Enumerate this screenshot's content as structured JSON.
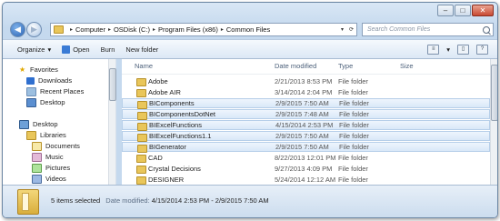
{
  "address": {
    "crumbs": [
      "Computer",
      "OSDisk (C:)",
      "Program Files (x86)",
      "Common Files"
    ]
  },
  "search": {
    "placeholder": "Search Common Files"
  },
  "toolbar": {
    "organize": "Organize",
    "open": "Open",
    "burn": "Burn",
    "new_folder": "New folder"
  },
  "nav": {
    "favorites": "Favorites",
    "downloads": "Downloads",
    "recent": "Recent Places",
    "desktop_fav": "Desktop",
    "desktop": "Desktop",
    "libraries": "Libraries",
    "documents": "Documents",
    "music": "Music",
    "pictures": "Pictures",
    "videos": "Videos"
  },
  "columns": {
    "name": "Name",
    "date": "Date modified",
    "type": "Type",
    "size": "Size"
  },
  "files": [
    {
      "name": "Adobe",
      "date": "2/21/2013 8:53 PM",
      "type": "File folder",
      "selected": false
    },
    {
      "name": "Adobe AIR",
      "date": "3/14/2014 2:04 PM",
      "type": "File folder",
      "selected": false
    },
    {
      "name": "BIComponents",
      "date": "2/9/2015 7:50 AM",
      "type": "File folder",
      "selected": true
    },
    {
      "name": "BIComponentsDotNet",
      "date": "2/9/2015 7:48 AM",
      "type": "File folder",
      "selected": true
    },
    {
      "name": "BIExcelFunctions",
      "date": "4/15/2014 2:53 PM",
      "type": "File folder",
      "selected": true
    },
    {
      "name": "BIExcelFunctions1.1",
      "date": "2/9/2015 7:50 AM",
      "type": "File folder",
      "selected": true
    },
    {
      "name": "BIGenerator",
      "date": "2/9/2015 7:50 AM",
      "type": "File folder",
      "selected": true
    },
    {
      "name": "CAD",
      "date": "8/22/2013 12:01 PM",
      "type": "File folder",
      "selected": false
    },
    {
      "name": "Crystal Decisions",
      "date": "9/27/2013 4:09 PM",
      "type": "File folder",
      "selected": false
    },
    {
      "name": "DESIGNER",
      "date": "5/24/2014 12:12 AM",
      "type": "File folder",
      "selected": false
    }
  ],
  "details": {
    "count": "5 items selected",
    "label": "Date modified:",
    "range": "4/15/2014 2:53 PM - 2/9/2015 7:50 AM"
  }
}
